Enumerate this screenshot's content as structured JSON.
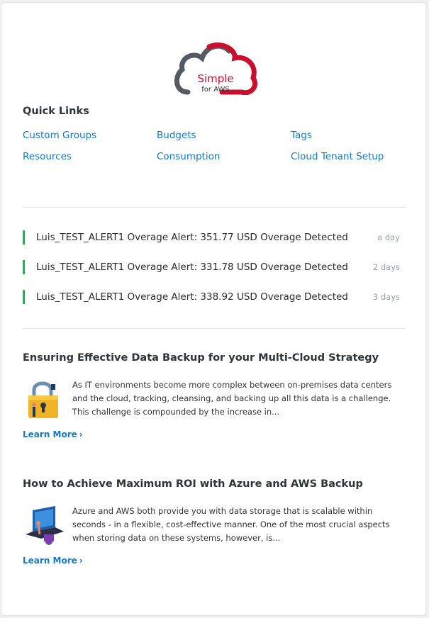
{
  "logo": {
    "brand": "Simple",
    "sub": "for AWS"
  },
  "quick_links": {
    "title": "Quick Links",
    "items": [
      "Custom Groups",
      "Budgets",
      "Tags",
      "Resources",
      "Consumption",
      "Cloud Tenant Setup"
    ]
  },
  "alerts": [
    {
      "message": "Luis_TEST_ALERT1 Overage Alert: 351.77 USD Overage Detected",
      "ago": "a day"
    },
    {
      "message": "Luis_TEST_ALERT1 Overage Alert: 331.78 USD Overage Detected",
      "ago": "2 days"
    },
    {
      "message": "Luis_TEST_ALERT1 Overage Alert: 338.92 USD Overage Detected",
      "ago": "3 days"
    }
  ],
  "articles": [
    {
      "title": "Ensuring Effective Data Backup for your Multi-Cloud Strategy",
      "body": "As IT environments become more complex between on-premises data centers and the cloud, tracking, cleansing, and backing up all this data is a challenge. This challenge is compounded by the increase in...",
      "learn_more": "Learn More"
    },
    {
      "title": "How to Achieve Maximum ROI with Azure and AWS Backup",
      "body": "Azure and AWS both provide you with data storage that is scalable within seconds - in a flexible, cost-effective manner. One of the most crucial aspects when storing data on these systems, however, is...",
      "learn_more": "Learn More"
    }
  ],
  "colors": {
    "link": "#1479c8",
    "alert_bar": "#3ba55c",
    "brand_red": "#c8102e"
  }
}
